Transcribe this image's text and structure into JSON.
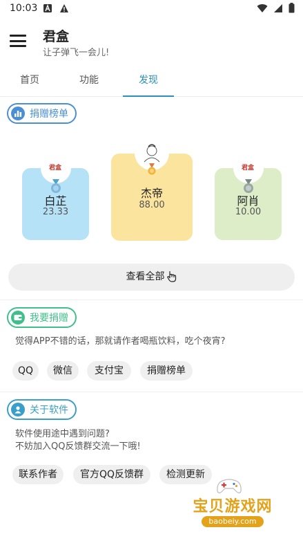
{
  "status_bar": {
    "time": "10:03"
  },
  "app_bar": {
    "title": "君盒",
    "subtitle": "让子弹飞一会儿!"
  },
  "tabs": [
    {
      "label": "首页",
      "active": false
    },
    {
      "label": "功能",
      "active": false
    },
    {
      "label": "发现",
      "active": true
    }
  ],
  "ranking": {
    "chip_label": "捐赠榜单",
    "entries": [
      {
        "rank": 2,
        "name": "白芷",
        "amount": "23.33",
        "color": "#b5e2f7"
      },
      {
        "rank": 1,
        "name": "杰帝",
        "amount": "88.00",
        "color": "#fbe49d"
      },
      {
        "rank": 3,
        "name": "阿肖",
        "amount": "10.00",
        "color": "#dcedc8"
      }
    ],
    "view_all_label": "查看全部",
    "badge_text": "君盒"
  },
  "donate": {
    "chip_label": "我要捐赠",
    "description": "觉得APP不错的话，那就请作者喝瓶饮料，吃个夜宵?",
    "buttons": [
      "QQ",
      "微信",
      "支付宝",
      "捐赠榜单"
    ]
  },
  "about": {
    "chip_label": "关于软件",
    "description_line1": "软件使用途中遇到问题?",
    "description_line2": "不妨加入QQ反馈群交流一下哦!",
    "buttons": [
      "联系作者",
      "官方QQ反馈群",
      "检测更新"
    ]
  },
  "watermark": {
    "title": "宝贝游戏网",
    "url": "baobeiy.com"
  },
  "colors": {
    "accent": "#2a8fb9",
    "ranking_chip": "#4a8fd6",
    "donate_chip": "#3fbf8a",
    "about_chip": "#3a9fc8"
  }
}
